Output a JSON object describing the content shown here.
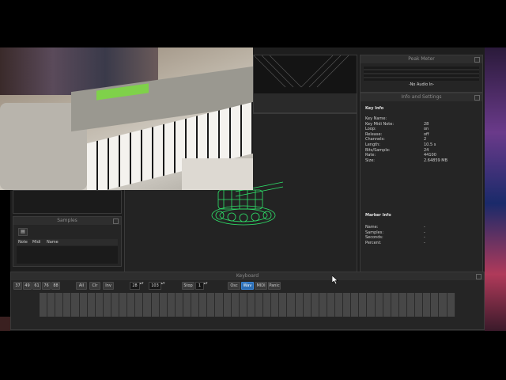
{
  "peak_meter": {
    "title": "Peak Meter",
    "status": "-No Audio In-"
  },
  "info_panel": {
    "title": "Info and Settings",
    "key_info": {
      "heading": "Key Info",
      "rows": [
        {
          "label": "Key Name:",
          "value": ""
        },
        {
          "label": "Key Midi Note:",
          "value": "28"
        },
        {
          "label": "Loop:",
          "value": "on"
        },
        {
          "label": "Release:",
          "value": "off"
        },
        {
          "label": "Channels:",
          "value": "2"
        },
        {
          "label": "Length:",
          "value": "10.5 s"
        },
        {
          "label": "Bits/Sample:",
          "value": "24"
        },
        {
          "label": "Rate:",
          "value": "44100"
        },
        {
          "label": "Size:",
          "value": "2.64859 MB"
        }
      ]
    },
    "marker_info": {
      "heading": "Marker Info",
      "rows": [
        {
          "label": "Name:",
          "value": "-"
        },
        {
          "label": "Samples:",
          "value": "-"
        },
        {
          "label": "Seconds:",
          "value": "-"
        },
        {
          "label": "Percent:",
          "value": "-"
        }
      ]
    }
  },
  "samples_panel": {
    "title": "Samples",
    "columns": [
      "Note",
      "Midi",
      "Name"
    ]
  },
  "keyboard_panel": {
    "title": "Keyboard",
    "key_counts": [
      "37",
      "49",
      "61",
      "76",
      "88"
    ],
    "select_buttons": [
      "All",
      "Clr",
      "Inv"
    ],
    "note_value": "28",
    "velocity_value": "103",
    "stop_label": "Stop",
    "stop_value": "1",
    "mode_buttons": [
      "Osc",
      "Wav",
      "MIDI",
      "Panic"
    ],
    "active_mode": "Wav"
  },
  "colors": {
    "accent": "#2d6fb5",
    "wireframe": "#2fe36a",
    "lcd": "#7fd14a"
  }
}
